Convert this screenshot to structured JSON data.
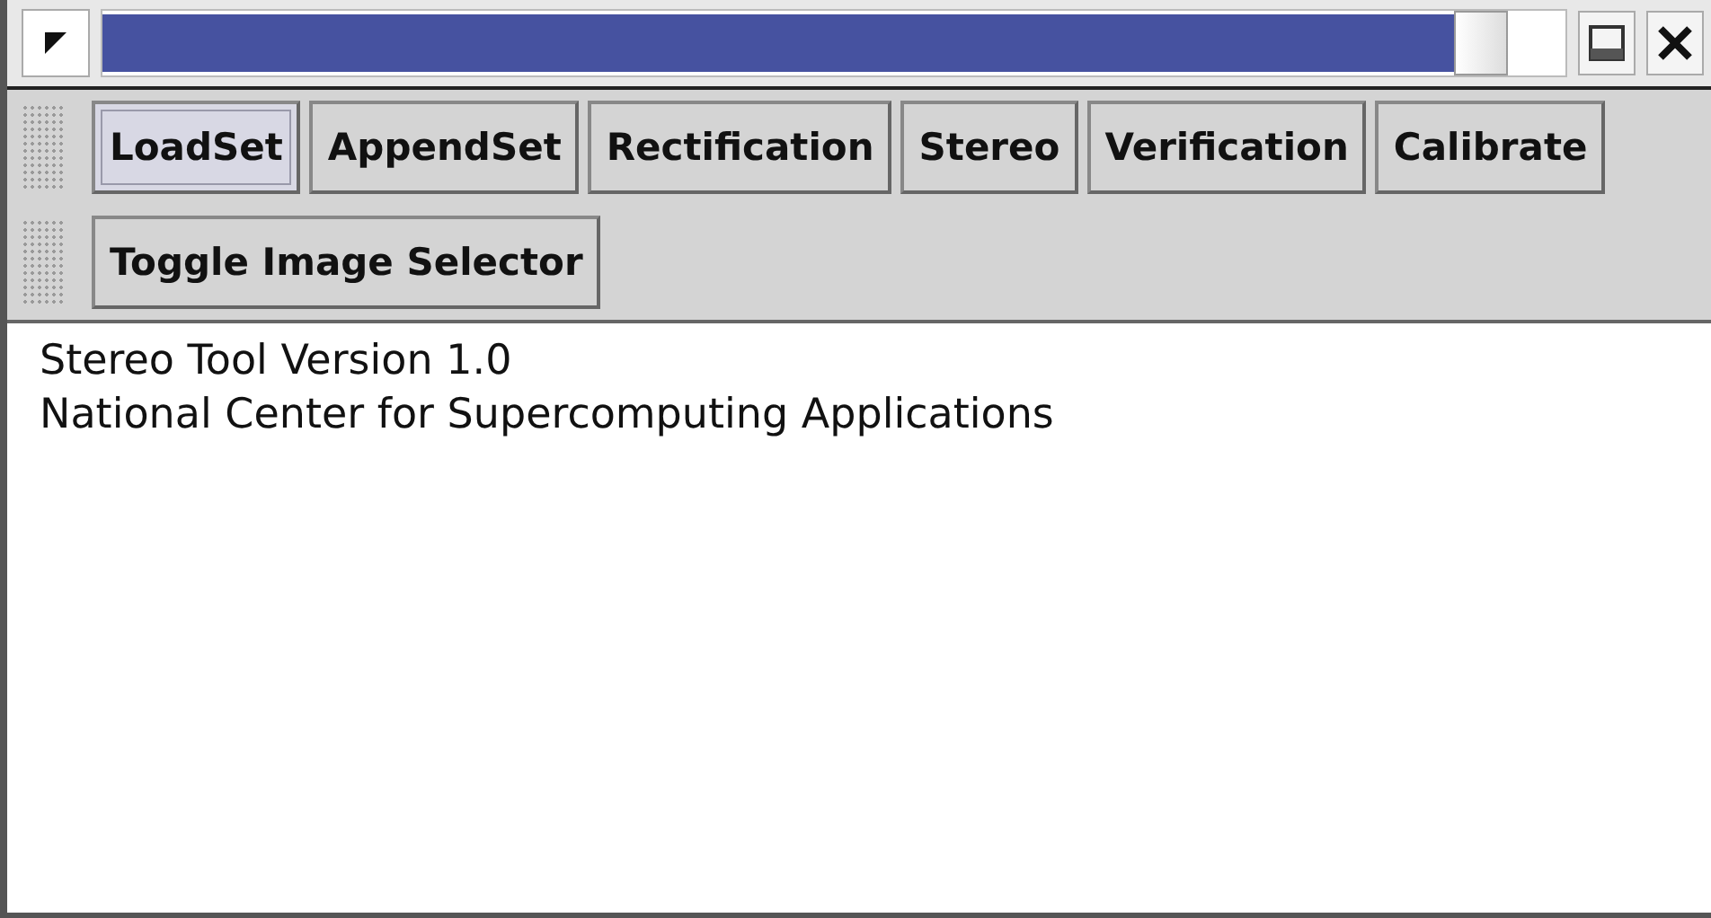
{
  "toolbar_rows": [
    {
      "buttons": [
        {
          "label": "LoadSet",
          "selected": true
        },
        {
          "label": "AppendSet",
          "selected": false
        },
        {
          "label": "Rectification",
          "selected": false
        },
        {
          "label": "Stereo",
          "selected": false
        },
        {
          "label": "Verification",
          "selected": false
        },
        {
          "label": "Calibrate",
          "selected": false
        }
      ]
    },
    {
      "buttons": [
        {
          "label": "Toggle Image Selector",
          "selected": false
        }
      ]
    }
  ],
  "text_area": {
    "lines": [
      "Stereo Tool Version 1.0",
      "National Center for Supercomputing Applications"
    ]
  }
}
